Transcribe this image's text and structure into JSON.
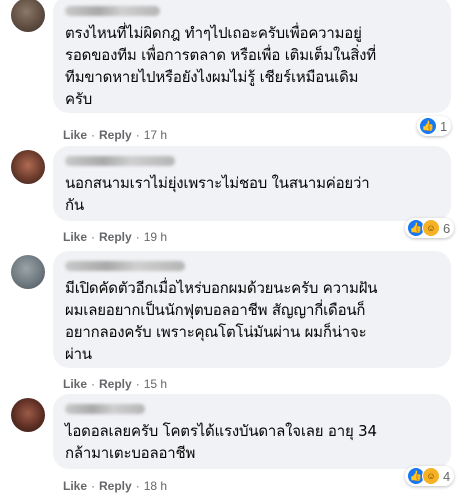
{
  "comments": [
    {
      "text": "ตรงไหนที่ไม่ผิดกฎ ทำๆไปเถอะครับเพื่อความอยู่\nรอดของทีม เพื่อการตลาด หรือเพื่อ เติมเต็มในสิ่งที่\nทีมขาดหายไปหรือยังไงผมไม่รู้ เชียร์เหมือนเดิม\nครับ",
      "like": "Like",
      "reply": "Reply",
      "time": "17 h",
      "reaction_count": "1",
      "reactions": [
        "like-icon"
      ]
    },
    {
      "text": "นอกสนามเราไม่ยุ่งเพราะไม่ชอบ ในสนามค่อยว่า\nกัน",
      "like": "Like",
      "reply": "Reply",
      "time": "19 h",
      "reaction_count": "6",
      "reactions": [
        "like-icon",
        "haha-icon"
      ]
    },
    {
      "text": "มีเปิดคัดตัวอีกเมื่อไหร่บอกผมด้วยนะครับ ความฝัน\nผมเลยอยากเป็นนักฟุตบอลอาชีพ สัญญากี่เดือนก็\nอยากลองครับ เพราะคุณโตโน่มันผ่าน ผมก็น่าจะ\nผ่าน",
      "like": "Like",
      "reply": "Reply",
      "time": "15 h",
      "reaction_count": "",
      "reactions": []
    },
    {
      "text": "ไอดอลเลยครับ โคตรได้แรงบันดาลใจเลย อายุ 34\nกล้ามาเตะบอลอาชีพ",
      "like": "Like",
      "reply": "Reply",
      "time": "18 h",
      "reaction_count": "4",
      "reactions": [
        "like-icon",
        "haha-icon"
      ]
    }
  ],
  "colors": {
    "bubble": "#f0f2f5",
    "meta": "#65676b",
    "like_blue": "#1877f2",
    "haha_yellow": "#f7b125"
  }
}
